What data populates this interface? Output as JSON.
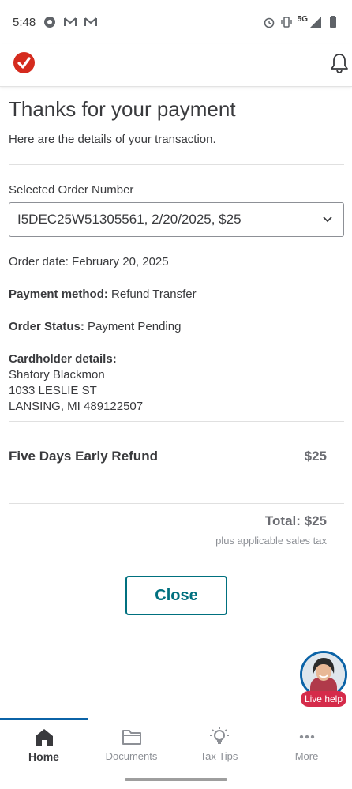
{
  "status_bar": {
    "time": "5:48",
    "network": "5G"
  },
  "header": {
    "logo_icon": "checkmark-logo-icon",
    "bell_icon": "notification-bell-icon",
    "brand_color": "#d52b1e"
  },
  "page": {
    "title": "Thanks for your payment",
    "subtitle": "Here are the details of your transaction."
  },
  "order_select": {
    "label": "Selected Order Number",
    "value": "I5DEC25W51305561, 2/20/2025, $25"
  },
  "order_info": {
    "order_date": "Order date: February 20, 2025",
    "payment_method_label": "Payment method:",
    "payment_method_value": "Refund Transfer",
    "order_status_label": "Order Status:",
    "order_status_value": "Payment Pending",
    "cardholder_label": "Cardholder details:",
    "cardholder_name": "Shatory Blackmon",
    "cardholder_street": "1033 LESLIE ST",
    "cardholder_city": "LANSING, MI 489122507"
  },
  "line_item": {
    "name": "Five Days Early Refund",
    "price": "$25"
  },
  "totals": {
    "total": "Total: $25",
    "note": "plus applicable sales tax"
  },
  "actions": {
    "close_label": "Close",
    "accent_color": "#00707f"
  },
  "live_help": {
    "label": "Live help"
  },
  "bottom_nav": {
    "items": [
      {
        "label": "Home",
        "icon": "home-icon",
        "active": true
      },
      {
        "label": "Documents",
        "icon": "folder-icon",
        "active": false
      },
      {
        "label": "Tax Tips",
        "icon": "lightbulb-icon",
        "active": false
      },
      {
        "label": "More",
        "icon": "more-dots-icon",
        "active": false
      }
    ]
  }
}
